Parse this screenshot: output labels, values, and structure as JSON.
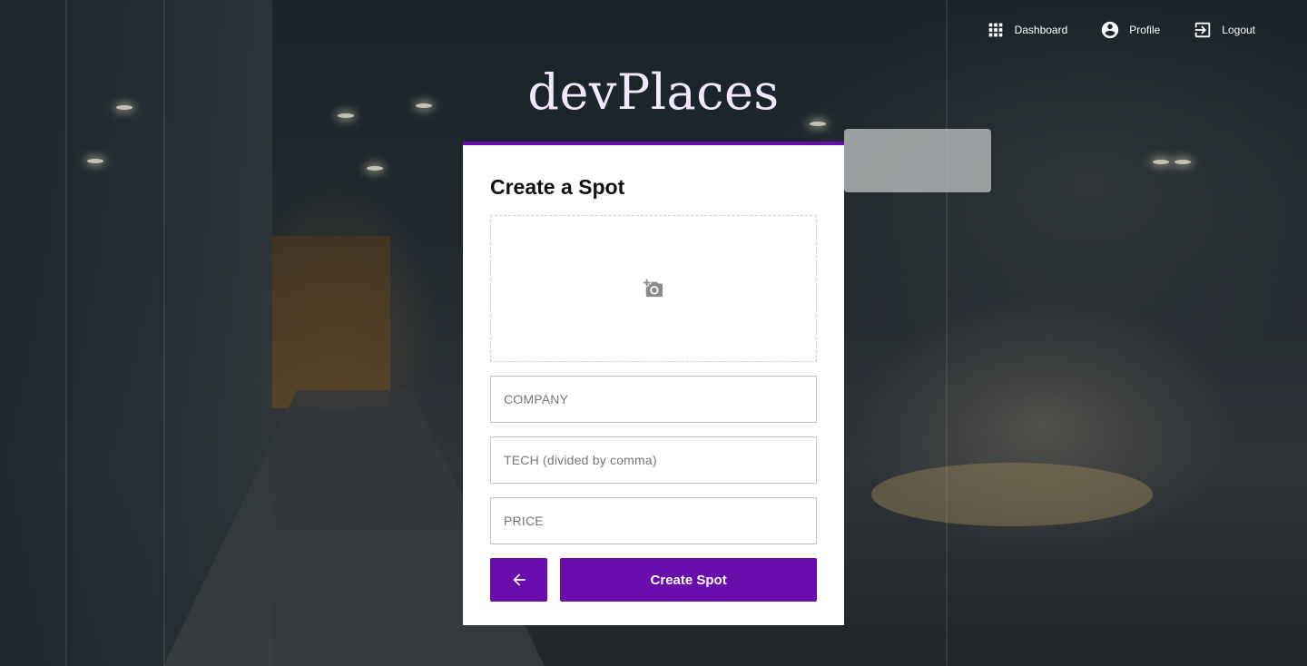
{
  "nav": {
    "items": [
      {
        "label": "Dashboard",
        "icon": "apps-grid-icon"
      },
      {
        "label": "Profile",
        "icon": "account-circle-icon"
      },
      {
        "label": "Logout",
        "icon": "exit-icon"
      }
    ]
  },
  "logo": {
    "text": "devPlaces"
  },
  "form": {
    "title": "Create a Spot",
    "upload_icon": "add-photo-icon",
    "company_placeholder": "COMPANY",
    "tech_placeholder": "TECH (divided by comma)",
    "price_placeholder": "PRICE",
    "back_icon": "arrow-left-icon",
    "submit_label": "Create Spot"
  },
  "colors": {
    "accent": "#6a0dad",
    "card_bg": "#ffffff",
    "logo": "#f2e9ff"
  }
}
